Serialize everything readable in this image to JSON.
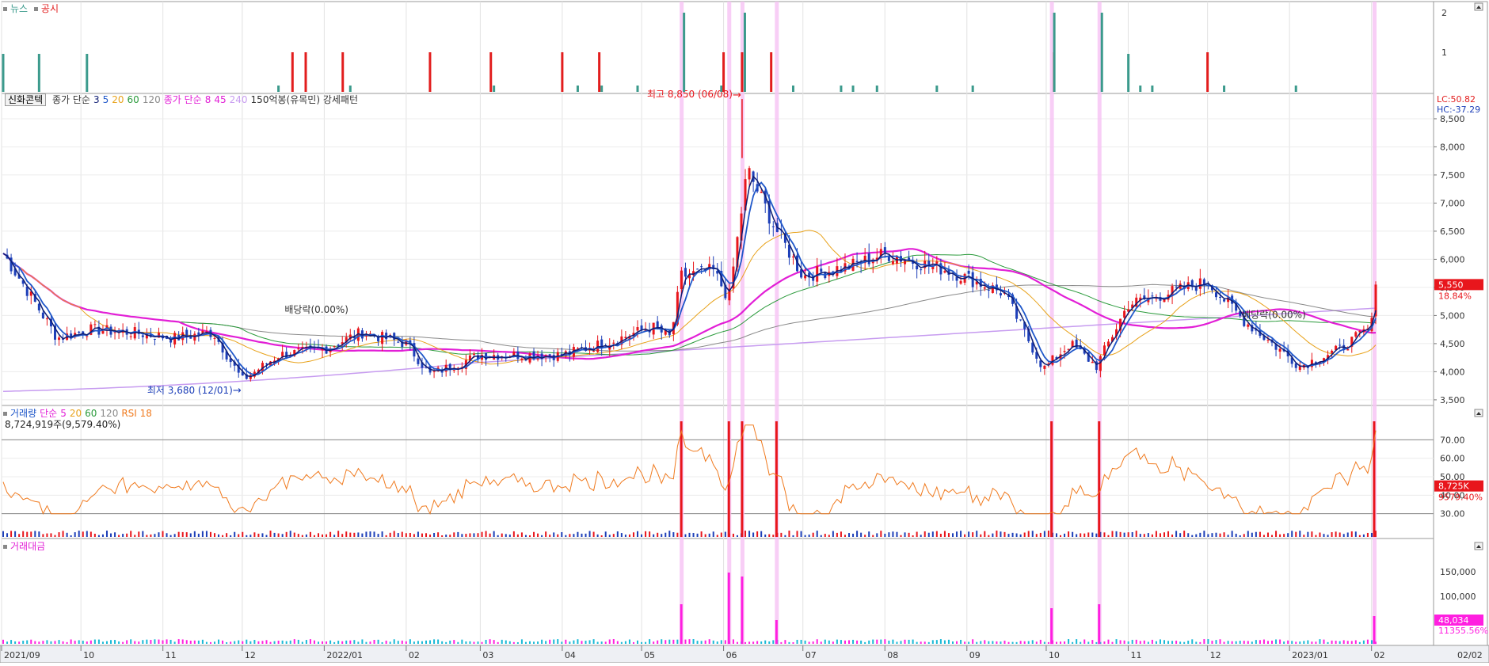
{
  "colors": {
    "up": "#e8161c",
    "down": "#1d3fb8",
    "news": "#3b9a8c",
    "notice": "#e21d1d",
    "ma3": "#0f1d73",
    "ma5": "#1f57c9",
    "ma20": "#e8a21b",
    "ma60": "#2a9a3b",
    "ma120": "#8a8a8a",
    "ma240": "#c79cf0",
    "ma45": "#e21fd6",
    "rsi": "#f07a1e",
    "highlight": "#f7c6f5",
    "amount": "#ff1fe0",
    "amount_small": "#19b9d6"
  },
  "news_panel": {
    "legend": [
      {
        "id": "news",
        "label": "뉴스"
      },
      {
        "id": "notice",
        "label": "공시"
      }
    ],
    "y_ticks": [
      "2",
      "1"
    ]
  },
  "price_panel": {
    "legend_tag": "신화콘텍",
    "legend_items": [
      {
        "text": "종가 단순",
        "color": "#333333"
      },
      {
        "text": "3",
        "color": "#0f1d73"
      },
      {
        "text": "5",
        "color": "#1f57c9"
      },
      {
        "text": "20",
        "color": "#e8a21b"
      },
      {
        "text": "60",
        "color": "#2a9a3b"
      },
      {
        "text": "120",
        "color": "#8a8a8a"
      },
      {
        "text": "종가 단순",
        "color": "#e21fd6"
      },
      {
        "text": "8",
        "color": "#e21fd6"
      },
      {
        "text": "45",
        "color": "#e21fd6"
      },
      {
        "text": "240",
        "color": "#c79cf0"
      },
      {
        "text": "150억봉(유목민) 강세패턴",
        "color": "#333333"
      }
    ],
    "lc": "LC:50.82",
    "hc": "HC:-37.29",
    "y_ticks": [
      "8,500",
      "8,000",
      "7,500",
      "7,000",
      "6,500",
      "6,000",
      "5,500",
      "5,000",
      "4,500",
      "4,000",
      "3,500"
    ],
    "last_price": "5,550",
    "last_change": "18.84%",
    "high_label": "최고 8,850 (06/08)",
    "low_label": "최저 3,680 (12/01)",
    "dividend_label_1": "배당락(0.00%)",
    "dividend_label_2": "배당락(0.00%)"
  },
  "volume_panel": {
    "legend_items": [
      {
        "text": "거래량",
        "color": "#1f57c9"
      },
      {
        "text": "단순",
        "color": "#e21fd6"
      },
      {
        "text": "5",
        "color": "#e21fd6"
      },
      {
        "text": "20",
        "color": "#e8a21b"
      },
      {
        "text": "60",
        "color": "#2a9a3b"
      },
      {
        "text": "120",
        "color": "#8a8a8a"
      },
      {
        "text": "RSI 18",
        "color": "#f07a1e"
      }
    ],
    "sub_label": "8,724,919주(9,579.40%)",
    "y_ticks": [
      "70.00",
      "60.00",
      "50.00",
      "40.00",
      "30.00"
    ],
    "last_volume": "8,725K",
    "last_pct": "9579.40%"
  },
  "amount_panel": {
    "legend": "거래대금",
    "y_ticks": [
      "150,000",
      "100,000",
      "50,000"
    ],
    "last_amount": "48,034",
    "last_pct": "11355.56%"
  },
  "x_axis": {
    "ticks": [
      "2021/09",
      "10",
      "11",
      "12",
      "2022/01",
      "02",
      "03",
      "04",
      "05",
      "06",
      "07",
      "08",
      "09",
      "10",
      "11",
      "12",
      "2023/01",
      "02"
    ],
    "last_label": "02/02"
  },
  "chart_data": {
    "type": "candlestick",
    "title": "",
    "xlabel": "",
    "ylabel": "",
    "x_range": [
      "2021/09",
      "2023/02/02"
    ],
    "ylim": [
      3500,
      8850
    ],
    "grid": true,
    "price_keypoints": [
      {
        "d": "2021-09-01",
        "v": 6150
      },
      {
        "d": "2021-09-10",
        "v": 5500
      },
      {
        "d": "2021-09-22",
        "v": 4600
      },
      {
        "d": "2021-10-05",
        "v": 4750
      },
      {
        "d": "2021-10-20",
        "v": 4700
      },
      {
        "d": "2021-11-05",
        "v": 4600
      },
      {
        "d": "2021-11-20",
        "v": 4700
      },
      {
        "d": "2021-12-01",
        "v": 3850
      },
      {
        "d": "2021-12-15",
        "v": 4300
      },
      {
        "d": "2022-01-01",
        "v": 4400
      },
      {
        "d": "2022-01-15",
        "v": 4700
      },
      {
        "d": "2022-02-01",
        "v": 4500
      },
      {
        "d": "2022-02-10",
        "v": 3950
      },
      {
        "d": "2022-03-01",
        "v": 4300
      },
      {
        "d": "2022-04-01",
        "v": 4300
      },
      {
        "d": "2022-04-20",
        "v": 4550
      },
      {
        "d": "2022-05-05",
        "v": 4800
      },
      {
        "d": "2022-05-12",
        "v": 4600
      },
      {
        "d": "2022-05-16",
        "v": 5700
      },
      {
        "d": "2022-05-28",
        "v": 5800
      },
      {
        "d": "2022-06-03",
        "v": 5300
      },
      {
        "d": "2022-06-10",
        "v": 7600
      },
      {
        "d": "2022-06-20",
        "v": 6600
      },
      {
        "d": "2022-07-01",
        "v": 5700
      },
      {
        "d": "2022-07-20",
        "v": 5900
      },
      {
        "d": "2022-08-01",
        "v": 6100
      },
      {
        "d": "2022-08-25",
        "v": 5800
      },
      {
        "d": "2022-09-15",
        "v": 5400
      },
      {
        "d": "2022-09-30",
        "v": 4050
      },
      {
        "d": "2022-10-10",
        "v": 4500
      },
      {
        "d": "2022-10-20",
        "v": 4100
      },
      {
        "d": "2022-11-01",
        "v": 5200
      },
      {
        "d": "2022-12-01",
        "v": 5600
      },
      {
        "d": "2022-12-15",
        "v": 4900
      },
      {
        "d": "2023-01-05",
        "v": 4100
      },
      {
        "d": "2023-01-20",
        "v": 4400
      },
      {
        "d": "2023-02-01",
        "v": 4800
      },
      {
        "d": "2023-02-02",
        "v": 5550
      }
    ],
    "high": {
      "date": "2022-06-08",
      "value": 8850
    },
    "low": {
      "date": "2021-12-01",
      "value": 3680
    },
    "last_close": 5550,
    "last_change_pct": 18.84,
    "rsi_period": 18,
    "rsi_last": 75,
    "last_volume": 8724919,
    "last_amount": 48034,
    "highlight_dates": [
      "2022-05-16",
      "2022-06-03",
      "2022-06-08",
      "2022-06-21",
      "2022-10-03",
      "2022-10-21",
      "2023-02-02"
    ]
  }
}
